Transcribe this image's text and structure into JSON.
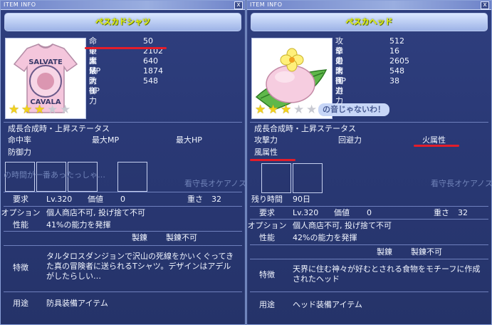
{
  "window_title": "ITEM INFO",
  "close_label": "x",
  "left": {
    "item_name": "ペスカドシャツ",
    "image_icon": "t-shirt-icon",
    "shirt_text": [
      "SALVATE",
      "CAVALA"
    ],
    "stars_on": 3,
    "stars_total": 5,
    "stats": [
      {
        "label": "命中率",
        "value": "50"
      },
      {
        "label": "最大MP",
        "value": "2102"
      },
      {
        "label": "魔法防御",
        "value": "640"
      },
      {
        "label": "最大HP",
        "value": "1874"
      },
      {
        "label": "防御力",
        "value": "548"
      }
    ],
    "growth_title": "成長合成時・上昇ステータス",
    "growth_items": [
      "命中率",
      "最大MP",
      "最大HP",
      "防御力"
    ],
    "ghost_text": "看守長オケアノス",
    "ghost_text2": "の時間が一番あったっしゃ…",
    "requirement_label": "要求",
    "requirement_value": "Lv.320",
    "price_label": "価値",
    "price_value": "0",
    "weight_label": "重さ",
    "weight_value": "32",
    "option_label": "オプション",
    "option_value": "個人商店不可, 投げ捨て不可",
    "performance_label": "性能",
    "performance_value": "41%の能力を発揮",
    "refine_label": "製錬",
    "refine_value": "製錬不可",
    "feature_label": "特徴",
    "feature_value": "タルタロスダンジョンで沢山の死線をかいくぐってきた真の冒険者に送られるTシャツ。デザインはアデルがしたらしい…",
    "usage_label": "用途",
    "usage_value": "防具装備アイテム"
  },
  "right": {
    "item_name": "ペスカヘッド",
    "image_icon": "flower-hat-icon",
    "stars_on": 3,
    "stars_total": 5,
    "bubble_text": "の音じゃないわ！",
    "stats": [
      {
        "label": "攻撃力",
        "value": "512"
      },
      {
        "label": "命中率",
        "value": "16"
      },
      {
        "label": "最大HP",
        "value": "2605"
      },
      {
        "label": "防御力",
        "value": "548"
      },
      {
        "label": "回避力",
        "value": "38"
      }
    ],
    "growth_title": "成長合成時・上昇ステータス",
    "growth_items": [
      "攻撃力",
      "回避力",
      "火属性",
      "風属性"
    ],
    "ghost_text": "看守長オケアノス",
    "time_label": "残り時間",
    "time_value": "90日",
    "requirement_label": "要求",
    "requirement_value": "Lv.320",
    "price_label": "価値",
    "price_value": "0",
    "weight_label": "重さ",
    "weight_value": "32",
    "option_label": "オプション",
    "option_value": "個人商店不可, 投げ捨て不可",
    "performance_label": "性能",
    "performance_value": "42%の能力を発揮",
    "refine_label": "製錬",
    "refine_value": "製錬不可",
    "feature_label": "特徴",
    "feature_value": "天界に住む神々が好むとされる食物をモチーフに作成されたヘッド",
    "usage_label": "用途",
    "usage_value": "ヘッド装備アイテム"
  },
  "colors": {
    "panel": "#2a3976",
    "name_text": "#e9f80a",
    "underline": "#e31d2a",
    "star_on": "#f2d21b",
    "star_off": "#c8cad2"
  }
}
